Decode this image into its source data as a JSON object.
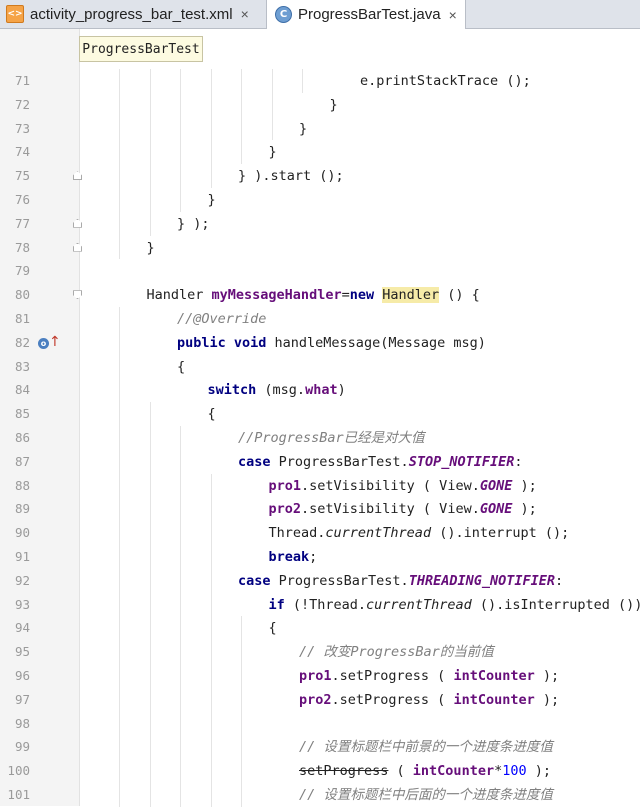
{
  "tabs": [
    {
      "label": "activity_progress_bar_test.xml",
      "icon": "xml-file-icon",
      "active": false
    },
    {
      "label": "ProgressBarTest.java",
      "icon": "java-class-icon",
      "active": true
    }
  ],
  "close_glyph": "×",
  "tooltip": "ProgressBarTest",
  "lines": [
    {
      "n": "71",
      "segs": [
        {
          "t": "e."
        },
        {
          "t": "printStackTrace"
        },
        {
          "t": " ();"
        }
      ]
    },
    {
      "n": "72",
      "segs": [
        {
          "t": "}"
        }
      ]
    },
    {
      "n": "73",
      "segs": [
        {
          "t": "}"
        }
      ]
    },
    {
      "n": "74",
      "segs": [
        {
          "t": "}"
        }
      ]
    },
    {
      "n": "75",
      "segs": [
        {
          "t": "} ).start ();"
        }
      ]
    },
    {
      "n": "76",
      "segs": [
        {
          "t": "}"
        }
      ]
    },
    {
      "n": "77",
      "segs": [
        {
          "t": "} );"
        }
      ]
    },
    {
      "n": "78",
      "segs": [
        {
          "t": "}"
        }
      ]
    },
    {
      "n": "79",
      "segs": []
    },
    {
      "n": "80",
      "segs": [
        {
          "t": "Handler "
        },
        {
          "t": "myMessageHandler",
          "c": "fld"
        },
        {
          "t": "="
        },
        {
          "t": "new",
          "c": "kw"
        },
        {
          "t": " "
        },
        {
          "t": "Handler",
          "c": "hl"
        },
        {
          "t": " () {"
        }
      ]
    },
    {
      "n": "81",
      "segs": [
        {
          "t": "//@Override",
          "c": "cmt"
        }
      ]
    },
    {
      "n": "82",
      "segs": [
        {
          "t": "public void",
          "c": "kw"
        },
        {
          "t": " handleMessage(Message msg)"
        }
      ]
    },
    {
      "n": "83",
      "segs": [
        {
          "t": "{"
        }
      ]
    },
    {
      "n": "84",
      "segs": [
        {
          "t": "switch",
          "c": "kw"
        },
        {
          "t": " (msg."
        },
        {
          "t": "what",
          "c": "fld"
        },
        {
          "t": ")"
        }
      ]
    },
    {
      "n": "85",
      "segs": [
        {
          "t": "{"
        }
      ]
    },
    {
      "n": "86",
      "segs": [
        {
          "t": "//ProgressBar已经是对大值",
          "c": "cmt"
        }
      ]
    },
    {
      "n": "87",
      "segs": [
        {
          "t": "case",
          "c": "kw"
        },
        {
          "t": " ProgressBarTest."
        },
        {
          "t": "STOP_NOTIFIER",
          "c": "cst"
        },
        {
          "t": ":"
        }
      ]
    },
    {
      "n": "88",
      "segs": [
        {
          "t": "pro1",
          "c": "fld"
        },
        {
          "t": ".setVisibility ( View."
        },
        {
          "t": "GONE",
          "c": "cst"
        },
        {
          "t": " );"
        }
      ]
    },
    {
      "n": "89",
      "segs": [
        {
          "t": "pro2",
          "c": "fld"
        },
        {
          "t": ".setVisibility ( View."
        },
        {
          "t": "GONE",
          "c": "cst"
        },
        {
          "t": " );"
        }
      ]
    },
    {
      "n": "90",
      "segs": [
        {
          "t": "Thread."
        },
        {
          "t": "currentThread",
          "c": "ital"
        },
        {
          "t": " ().interrupt ();"
        }
      ]
    },
    {
      "n": "91",
      "segs": [
        {
          "t": "break",
          "c": "kw"
        },
        {
          "t": ";"
        }
      ]
    },
    {
      "n": "92",
      "segs": [
        {
          "t": "case",
          "c": "kw"
        },
        {
          "t": " ProgressBarTest."
        },
        {
          "t": "THREADING_NOTIFIER",
          "c": "cst"
        },
        {
          "t": ":"
        }
      ]
    },
    {
      "n": "93",
      "segs": [
        {
          "t": "if",
          "c": "kw"
        },
        {
          "t": " (!Thread."
        },
        {
          "t": "currentThread",
          "c": "ital"
        },
        {
          "t": " ().isInterrupted ())"
        }
      ]
    },
    {
      "n": "94",
      "segs": [
        {
          "t": "{"
        }
      ]
    },
    {
      "n": "95",
      "segs": [
        {
          "t": "// 改变ProgressBar的当前值",
          "c": "cmt"
        }
      ]
    },
    {
      "n": "96",
      "segs": [
        {
          "t": "pro1",
          "c": "fld"
        },
        {
          "t": ".setProgress ( "
        },
        {
          "t": "intCounter",
          "c": "fld"
        },
        {
          "t": " );"
        }
      ]
    },
    {
      "n": "97",
      "segs": [
        {
          "t": "pro2",
          "c": "fld"
        },
        {
          "t": ".setProgress ( "
        },
        {
          "t": "intCounter",
          "c": "fld"
        },
        {
          "t": " );"
        }
      ]
    },
    {
      "n": "98",
      "segs": []
    },
    {
      "n": "99",
      "segs": [
        {
          "t": "// 设置标题栏中前景的一个进度条进度值",
          "c": "cmt"
        }
      ]
    },
    {
      "n": "100",
      "segs": [
        {
          "t": "setProgress",
          "c": "strike"
        },
        {
          "t": " ( "
        },
        {
          "t": "intCounter",
          "c": "fld"
        },
        {
          "t": "*"
        },
        {
          "t": "100",
          "c": "num"
        },
        {
          "t": " );"
        }
      ]
    },
    {
      "n": "101",
      "segs": [
        {
          "t": "// 设置标题栏中后面的一个进度条进度值",
          "c": "cmt"
        }
      ]
    }
  ]
}
